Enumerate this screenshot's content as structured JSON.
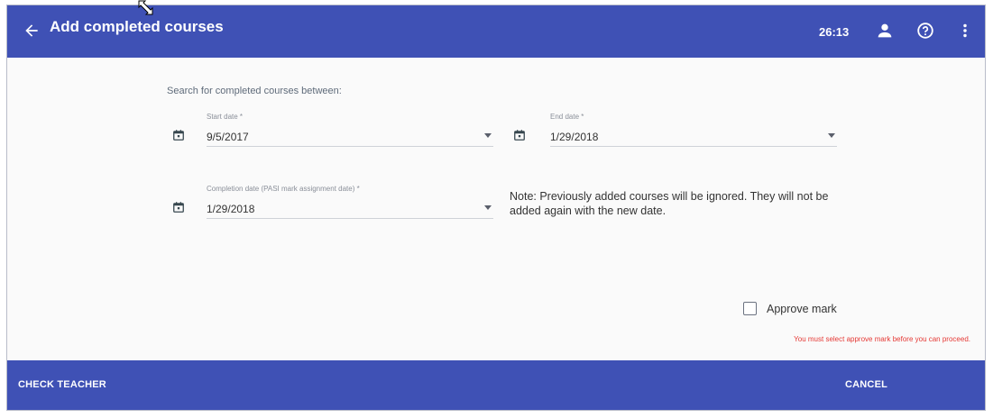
{
  "header": {
    "title": "Add completed courses",
    "timer": "26:13",
    "icons": [
      "arrow-back-icon",
      "person-icon",
      "help-icon",
      "more-vert-icon"
    ]
  },
  "form": {
    "search_label": "Search for completed courses between:",
    "start_date": {
      "label": "Start date *",
      "value": "9/5/2017"
    },
    "end_date": {
      "label": "End date *",
      "value": "1/29/2018"
    },
    "completion_date": {
      "label": "Completion date (PASI mark assignment date) *",
      "value": "1/29/2018"
    },
    "note": "Note: Previously added courses will be ignored. They will not be added again with the new date.",
    "approve_mark": {
      "label": "Approve mark",
      "checked": false
    },
    "error": "You must select approve mark before you can proceed."
  },
  "footer": {
    "check_teacher": "CHECK TEACHER",
    "cancel": "CANCEL"
  },
  "colors": {
    "primary": "#3f51b5",
    "error": "#e53935",
    "background": "#fafafa"
  }
}
